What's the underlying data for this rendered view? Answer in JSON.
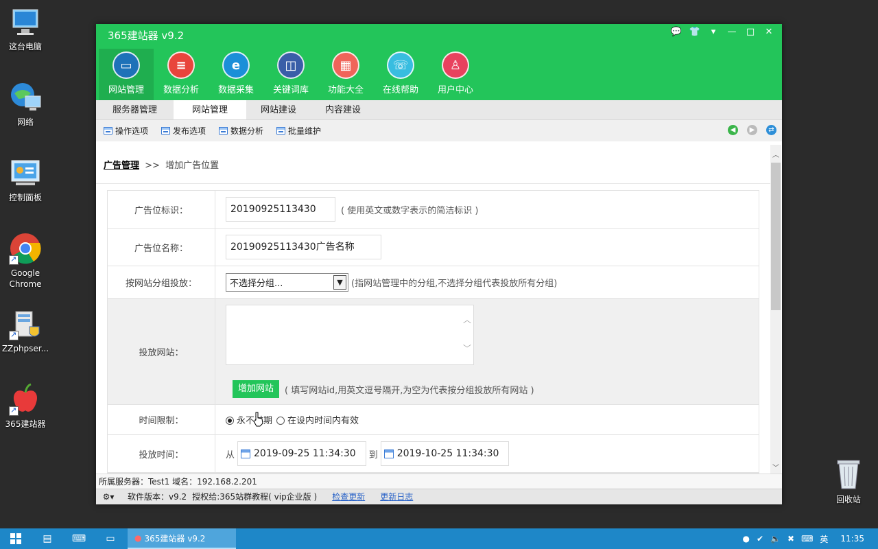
{
  "desktop": {
    "icons": [
      {
        "label": "这台电脑"
      },
      {
        "label": "网络"
      },
      {
        "label": "控制面板"
      },
      {
        "label": "Google Chrome"
      },
      {
        "label": "ZZphpser..."
      },
      {
        "label": "365建站器"
      },
      {
        "label": "回收站"
      }
    ]
  },
  "app": {
    "title": "365建站器 v9.2",
    "window_controls": [
      "💬",
      "👕",
      "▾",
      "—",
      "□",
      "✕"
    ],
    "nav": [
      {
        "label": "网站管理",
        "icon": "monitor-icon",
        "color": "#1e72b8"
      },
      {
        "label": "数据分析",
        "icon": "database-icon",
        "color": "#e8453c"
      },
      {
        "label": "数据采集",
        "icon": "globe-icon",
        "color": "#1b8fd8"
      },
      {
        "label": "关键词库",
        "icon": "book-icon",
        "color": "#3a5ea8"
      },
      {
        "label": "功能大全",
        "icon": "grid-icon",
        "color": "#f0645a"
      },
      {
        "label": "在线帮助",
        "icon": "headset-icon",
        "color": "#38bde0"
      },
      {
        "label": "用户中心",
        "icon": "user-icon",
        "color": "#e8425e"
      }
    ],
    "tabs": [
      "服务器管理",
      "网站管理",
      "网站建设",
      "内容建设"
    ],
    "toolbar": [
      "操作选项",
      "发布选项",
      "数据分析",
      "批量维护"
    ],
    "breadcrumb": {
      "link": "广告管理",
      "sep": ">>",
      "current": "增加广告位置"
    },
    "form": {
      "ad_id": {
        "label": "广告位标识：",
        "value": "20190925113430",
        "hint": "( 使用英文或数字表示的简洁标识 )"
      },
      "ad_name": {
        "label": "广告位名称：",
        "value": "20190925113430广告名称"
      },
      "group": {
        "label": "按网站分组投放：",
        "selected": "不选择分组...",
        "hint": "(指网站管理中的分组,不选择分组代表投放所有分组)"
      },
      "sites": {
        "label": "投放网站：",
        "button": "增加网站",
        "hint": "( 填写网站id,用英文逗号隔开,为空为代表按分组投放所有网站 )"
      },
      "time_limit": {
        "label": "时间限制：",
        "option1": "永不过期",
        "option2": "在设内时间内有效"
      },
      "schedule": {
        "label": "投放时间：",
        "from": "从",
        "start": "2019-09-25 11:34:30",
        "to": "到",
        "end": "2019-10-25 11:34:30"
      }
    },
    "status1": "所属服务器：Test1 域名：192.168.2.201",
    "status2": {
      "version": "软件版本：v9.2",
      "license": "授权给:365站群教程( vip企业版 )",
      "check": "检查更新",
      "log": "更新日志"
    }
  },
  "taskbar": {
    "app_label": "365建站器 v9.2",
    "ime": "英",
    "time": "11:35"
  }
}
